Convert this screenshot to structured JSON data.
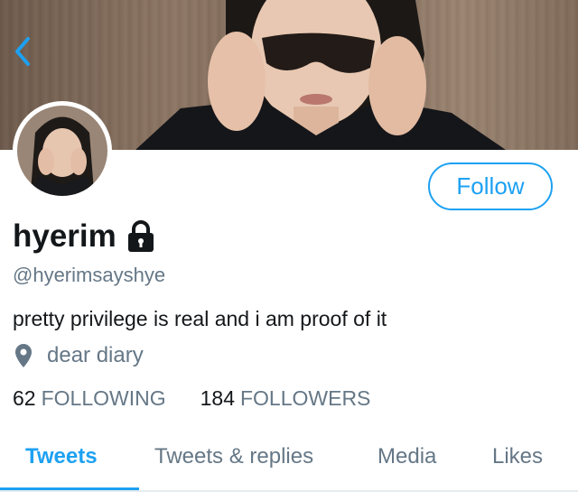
{
  "header": {
    "back_icon": "chevron-left-icon"
  },
  "profile": {
    "display_name": "hyerim",
    "locked_icon": "lock-icon",
    "handle": "@hyerimsayshye",
    "bio": "pretty privilege is real and i am proof of it",
    "location_icon": "location-pin-icon",
    "location": "dear diary"
  },
  "actions": {
    "follow_label": "Follow"
  },
  "stats": {
    "following_count": "62",
    "following_label": "FOLLOWING",
    "followers_count": "184",
    "followers_label": "FOLLOWERS"
  },
  "tabs": [
    {
      "label": "Tweets",
      "active": true
    },
    {
      "label": "Tweets & replies",
      "active": false
    },
    {
      "label": "Media",
      "active": false
    },
    {
      "label": "Likes",
      "active": false
    }
  ],
  "colors": {
    "accent": "#1da1f2",
    "secondary_text": "#657786",
    "primary_text": "#14171a"
  }
}
